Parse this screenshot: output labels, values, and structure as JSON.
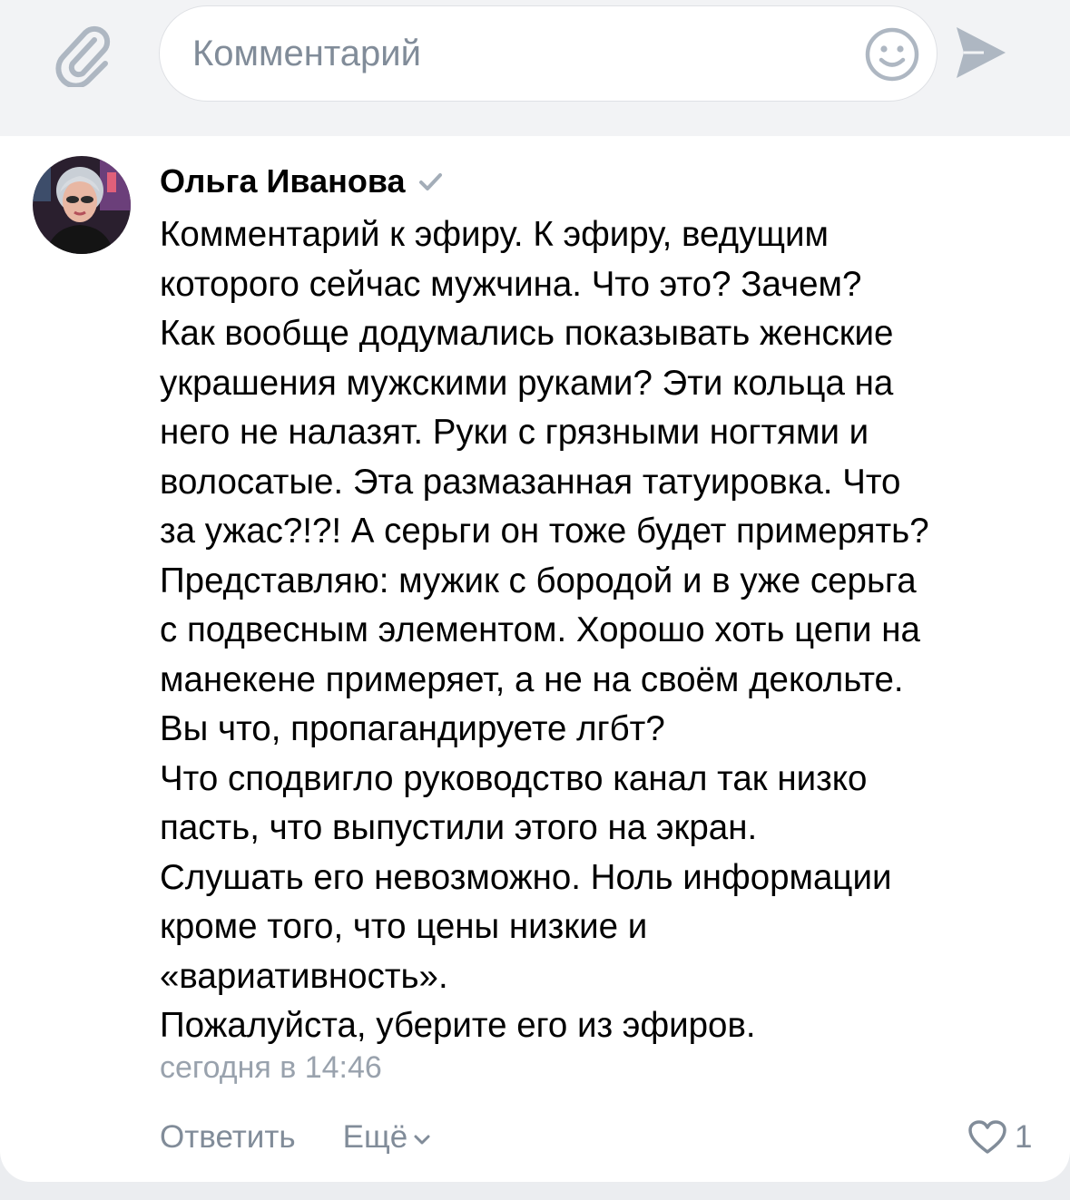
{
  "composer": {
    "placeholder": "Комментарий",
    "attach_icon": "paperclip-icon",
    "emoji_icon": "smiley-icon",
    "send_icon": "send-arrow-icon"
  },
  "comment": {
    "author": "Ольга Иванова",
    "verified_icon": "check-icon",
    "text": "Комментарий к эфиру. К эфиру, ведущим\nкоторого сейчас мужчина. Что это? Зачем?\nКак вообще додумались показывать женские\nукрашения мужскими руками? Эти кольца на\nнего не налазят. Руки с грязными ногтями и\nволосатые. Эта размазанная татуировка. Что\nза ужас?!?! А серьги он тоже будет примерять?\nПредставляю: мужик с бородой и в уже серьга\nс подвесным элементом. Хорошо хоть цепи на\nманекене примеряет, а не на своём декольте.\nВы что, пропагандируете лгбт?\nЧто сподвигло руководство канал так низко\nпасть, что выпустили этого на экран.\nСлушать его невозможно. Ноль информации\nкроме того, что цены низкие и\n«вариативность».\nПожалуйста, уберите его из эфиров.",
    "timestamp": "сегодня в 14:46",
    "reply_label": "Ответить",
    "more_label": "Ещё",
    "likes": "1"
  },
  "colors": {
    "page_bg": "#f2f3f5",
    "card_bg": "#ffffff",
    "secondary_text": "#818c99",
    "timestamp_text": "#99a2ad",
    "icon_gray": "#aeb7c2"
  }
}
